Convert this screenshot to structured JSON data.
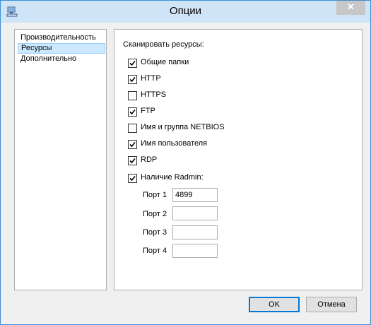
{
  "window": {
    "title": "Опции"
  },
  "nav": {
    "items": [
      {
        "label": "Производительность",
        "selected": false
      },
      {
        "label": "Ресурсы",
        "selected": true
      },
      {
        "label": "Дополнительно",
        "selected": false
      }
    ]
  },
  "resources": {
    "scan_label": "Сканировать ресурсы:",
    "checkboxes": [
      {
        "label": "Общие папки",
        "checked": true
      },
      {
        "label": "HTTP",
        "checked": true
      },
      {
        "label": "HTTPS",
        "checked": false
      },
      {
        "label": "FTP",
        "checked": true
      },
      {
        "label": "Имя и группа NETBIOS",
        "checked": false
      },
      {
        "label": "Имя пользователя",
        "checked": true
      },
      {
        "label": "RDP",
        "checked": true
      },
      {
        "label": "Наличие Radmin:",
        "checked": true
      }
    ],
    "ports": [
      {
        "label": "Порт 1",
        "value": "4899"
      },
      {
        "label": "Порт 2",
        "value": ""
      },
      {
        "label": "Порт 3",
        "value": ""
      },
      {
        "label": "Порт 4",
        "value": ""
      }
    ]
  },
  "buttons": {
    "ok": "OK",
    "cancel": "Отмена"
  }
}
